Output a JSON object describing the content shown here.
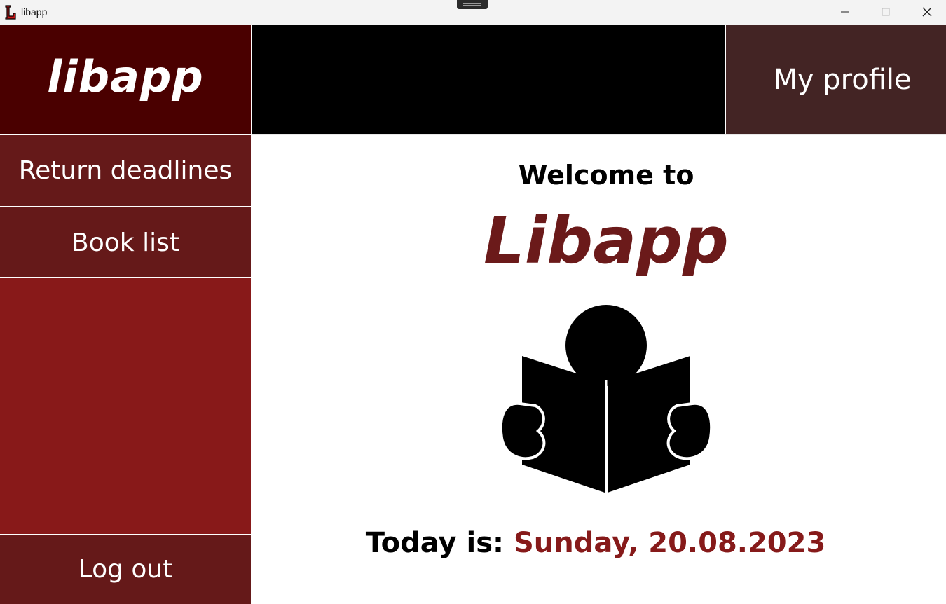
{
  "window": {
    "title": "libapp",
    "icon": "libapp-L-icon",
    "controls": [
      "minimize-icon",
      "maximize-icon",
      "close-icon"
    ]
  },
  "sidebar": {
    "logo": "libapp",
    "items": [
      {
        "label": "Return deadlines"
      },
      {
        "label": "Book list"
      }
    ],
    "logout_label": "Log out"
  },
  "header": {
    "profile_label": "My profile"
  },
  "main": {
    "welcome_text": "Welcome to",
    "brand_name": "Libapp",
    "illustration": "person-reading-book-icon",
    "today_label": "Today is:",
    "today_date": "Sunday, 20.08.2023"
  },
  "colors": {
    "logo_panel": "#4a0000",
    "nav_button": "#651919",
    "sidebar_fill": "#881919",
    "profile_button": "#432424",
    "brand_text": "#6b1a1a",
    "date_text": "#861a1a"
  }
}
